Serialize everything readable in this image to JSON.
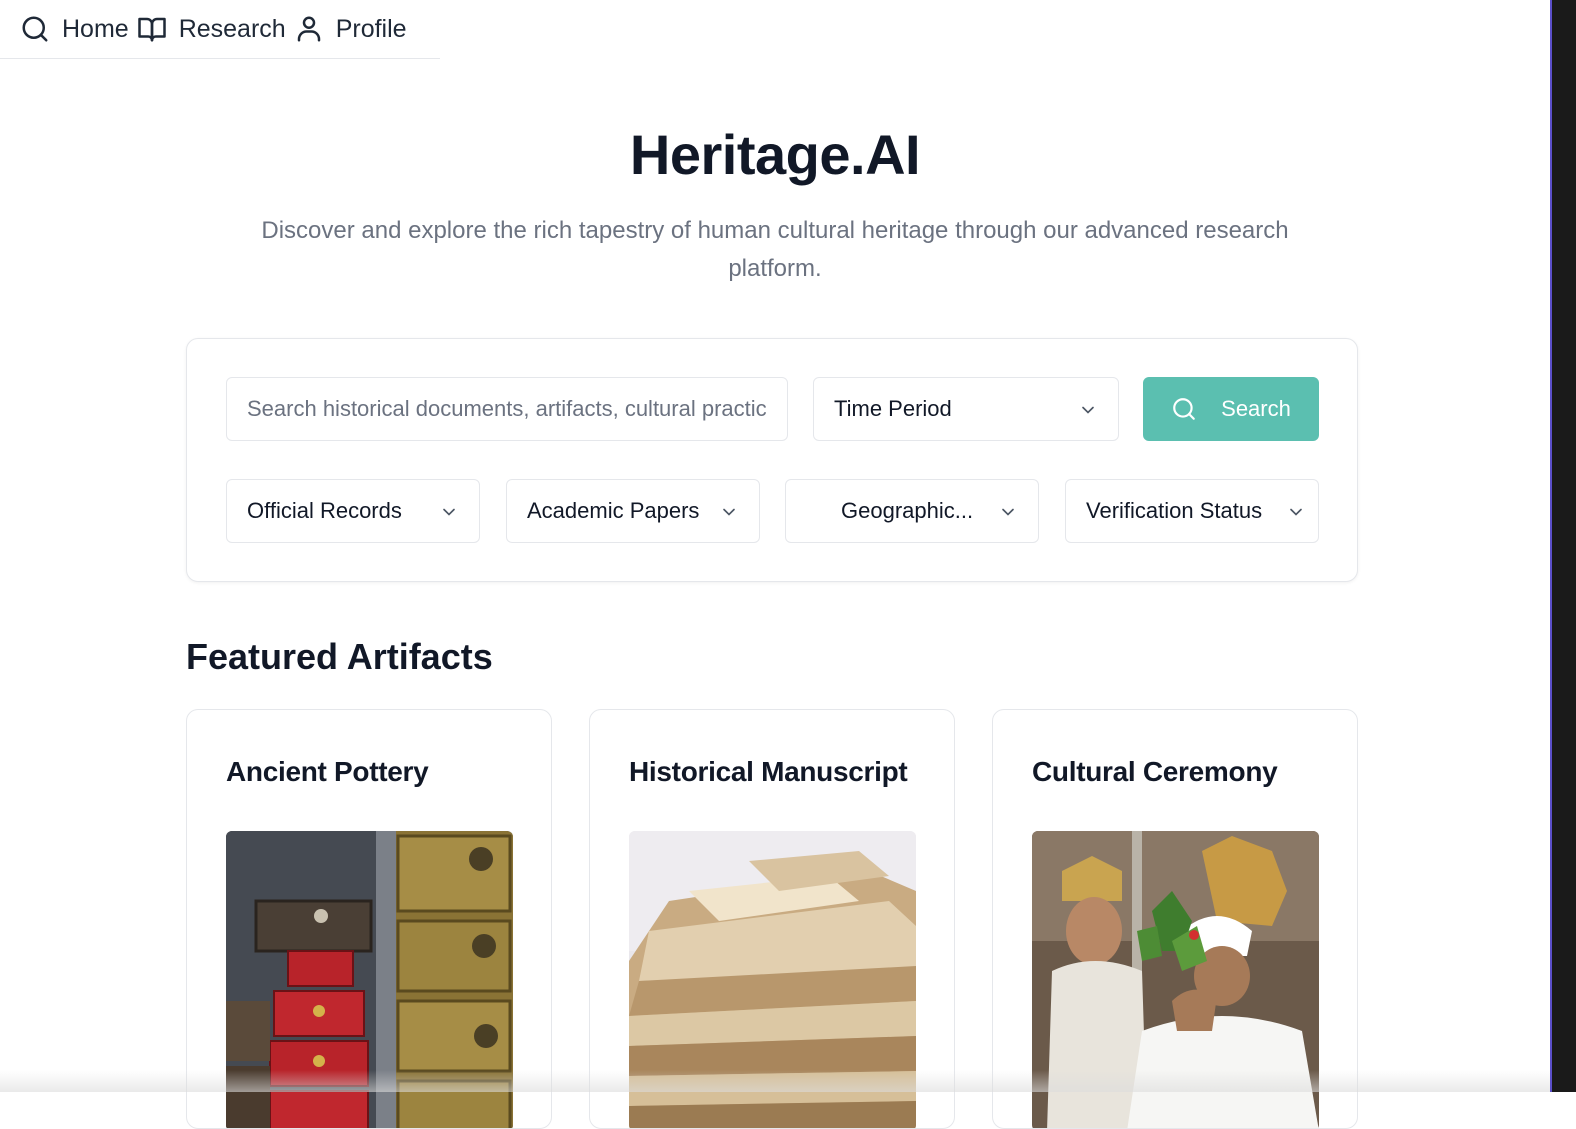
{
  "nav": {
    "items": [
      {
        "label": "Home",
        "icon": "search-icon"
      },
      {
        "label": "Research",
        "icon": "book-open-icon"
      },
      {
        "label": "Profile",
        "icon": "user-icon"
      }
    ]
  },
  "hero": {
    "title": "Heritage.AI",
    "subtitle": "Discover and explore the rich tapestry of human cultural heritage through our advanced research platform."
  },
  "search": {
    "placeholder": "Search historical documents, artifacts, cultural practices...",
    "time_period": "Time Period",
    "button_label": "Search",
    "filters": [
      "Official Records",
      "Academic Papers",
      "Geographic...",
      "Verification Status"
    ]
  },
  "featured": {
    "title": "Featured Artifacts",
    "cards": [
      {
        "title": "Ancient Pottery"
      },
      {
        "title": "Historical Manuscript"
      },
      {
        "title": "Cultural Ceremony"
      }
    ]
  },
  "colors": {
    "accent": "#5bbfb0",
    "text": "#111827",
    "muted": "#6b7280",
    "border": "#e5e7eb"
  }
}
